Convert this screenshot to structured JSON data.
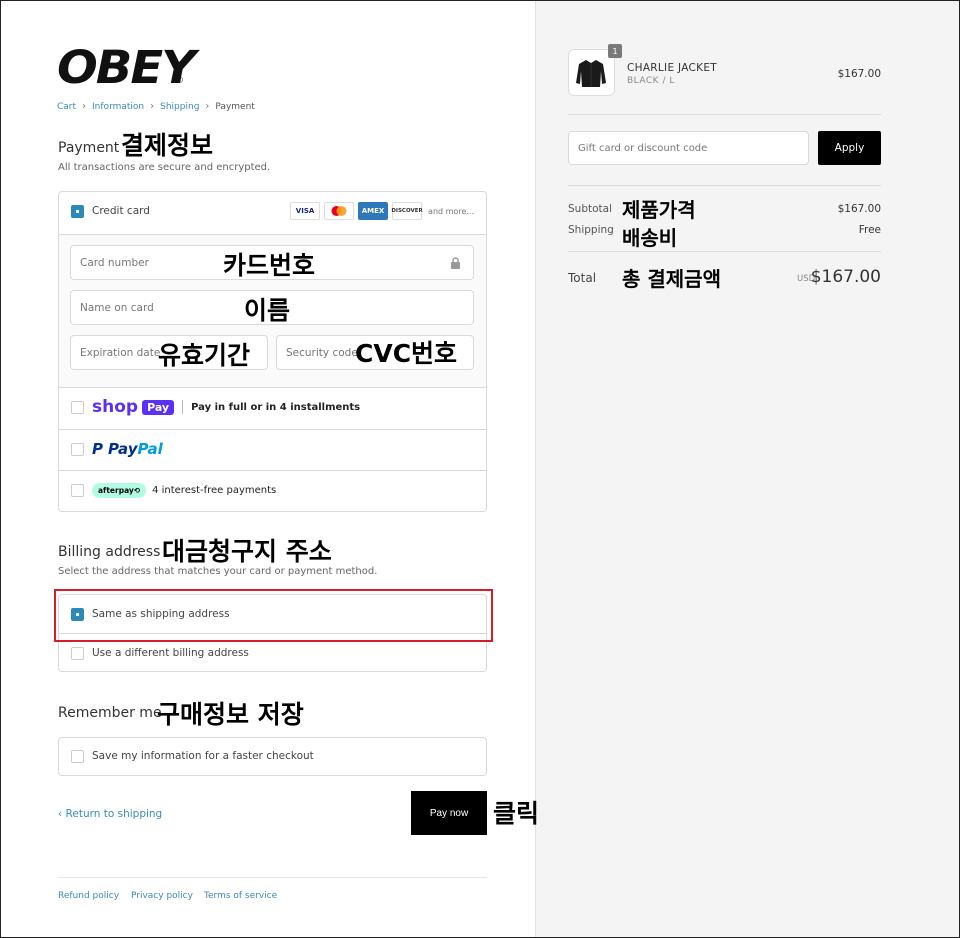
{
  "brand": {
    "name": "OBEY",
    "reg": "®"
  },
  "breadcrumb": {
    "cart": "Cart",
    "information": "Information",
    "shipping": "Shipping",
    "payment": "Payment"
  },
  "payment": {
    "title": "Payment",
    "annotation": "결제정보",
    "subtitle": "All transactions are secure and encrypted.",
    "credit_card_label": "Credit card",
    "card_brands": [
      "VISA",
      "MC",
      "AMEX",
      "DISCOVER"
    ],
    "and_more": "and more...",
    "card_number_placeholder": "Card number",
    "card_number_annotation": "카드번호",
    "name_placeholder": "Name on card",
    "name_annotation": "이름",
    "expiration_placeholder": "Expiration date",
    "expiration_annotation": "유효기간",
    "security_placeholder": "Security code",
    "security_annotation": "CVC번호",
    "shoppay_logo": "shop",
    "shoppay_pay": "Pay",
    "shoppay_text": "Pay in full or in 4 installments",
    "paypal_p": "P",
    "paypal_1": "Pay",
    "paypal_2": "Pal",
    "afterpay_logo": "afterpay⟲",
    "afterpay_text": "4 interest-free payments"
  },
  "billing": {
    "title": "Billing address",
    "annotation": "대금청구지 주소",
    "subtitle": "Select the address that matches your card or payment method.",
    "same_label": "Same as shipping address",
    "different_label": "Use a different billing address"
  },
  "remember": {
    "title": "Remember me",
    "annotation": "구매정보 저장",
    "save_label": "Save my information for a faster checkout"
  },
  "actions": {
    "return_label": "Return to shipping",
    "pay_now_label": "Pay now",
    "click_annotation": "클릭"
  },
  "footer": {
    "refund": "Refund policy",
    "privacy": "Privacy policy",
    "terms": "Terms of service"
  },
  "summary": {
    "product_name": "CHARLIE JACKET",
    "product_variant": "BLACK / L",
    "product_qty": "1",
    "product_price": "$167.00",
    "gift_placeholder": "Gift card or discount code",
    "apply_label": "Apply",
    "subtotal_label": "Subtotal",
    "subtotal_annotation": "제품가격",
    "subtotal_value": "$167.00",
    "shipping_label": "Shipping",
    "shipping_annotation": "배송비",
    "shipping_value": "Free",
    "total_label": "Total",
    "total_annotation": "총 결제금액",
    "currency": "USD",
    "total_value": "$167.00"
  },
  "colors": {
    "accent": "#2b8ab9",
    "link": "#3a8bb7",
    "highlight_box": "#d21f2b",
    "shoppay": "#5a31f4"
  }
}
